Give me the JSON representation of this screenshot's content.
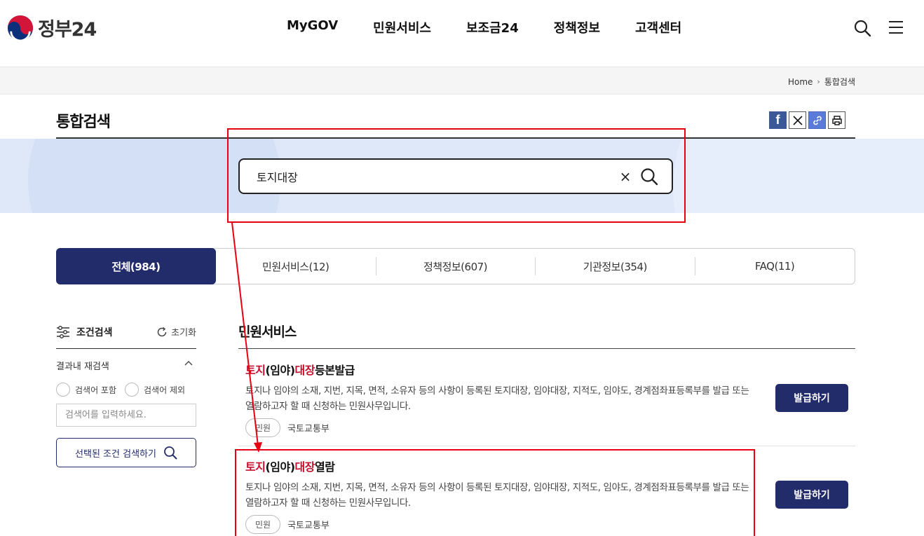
{
  "header": {
    "logo_text": "정부24",
    "nav": [
      "MyGOV",
      "민원서비스",
      "보조금24",
      "정책정보",
      "고객센터"
    ]
  },
  "breadcrumb": {
    "home": "Home",
    "current": "통합검색"
  },
  "page_title": "통합검색",
  "search": {
    "value": "토지대장",
    "clear_symbol": "×"
  },
  "tabs": [
    {
      "label": "전체(984)",
      "active": true
    },
    {
      "label": "민원서비스(12)",
      "active": false
    },
    {
      "label": "정책정보(607)",
      "active": false
    },
    {
      "label": "기관정보(354)",
      "active": false
    },
    {
      "label": "FAQ(11)",
      "active": false
    }
  ],
  "filter": {
    "title": "조건검색",
    "reset": "초기화",
    "refine_label": "결과내 재검색",
    "include": "검색어 포함",
    "exclude": "검색어 제외",
    "placeholder": "검색어를 입력하세요.",
    "submit": "선택된 조건 검색하기"
  },
  "results": {
    "section_title": "민원서비스",
    "items": [
      {
        "t1": "토지",
        "t2": "(임야)",
        "t3": "대장",
        "t4": "등본발급",
        "desc": "토지나 임야의 소재, 지번, 지목, 면적, 소유자 등의 사항이 등록된 토지대장, 임야대장, 지적도, 임야도, 경계점좌표등록부를 발급 또는 열람하고자 할 때 신청하는 민원사무입니다.",
        "badge": "민원",
        "org": "국토교통부",
        "button": "발급하기"
      },
      {
        "t1": "토지",
        "t2": "(임야)",
        "t3": "대장",
        "t4": "열람",
        "desc": "토지나 임야의 소재, 지번, 지목, 면적, 소유자 등의 사항이 등록된 토지대장, 임야대장, 지적도, 임야도, 경계점좌표등록부를 발급 또는 열람하고자 할 때 신청하는 민원사무입니다.",
        "badge": "민원",
        "org": "국토교통부",
        "button": "발급하기"
      }
    ]
  },
  "colors": {
    "primary_navy": "#232c6b",
    "highlight_red": "#c8102e",
    "annotation_red": "#e60012",
    "search_band": "#dfe8f9"
  },
  "icons": [
    "taegeuk-logo-icon",
    "search-icon",
    "hamburger-menu-icon",
    "facebook-icon",
    "x-icon",
    "link-icon",
    "print-icon",
    "close-icon",
    "filter-sliders-icon",
    "refresh-icon",
    "chevron-up-icon"
  ]
}
